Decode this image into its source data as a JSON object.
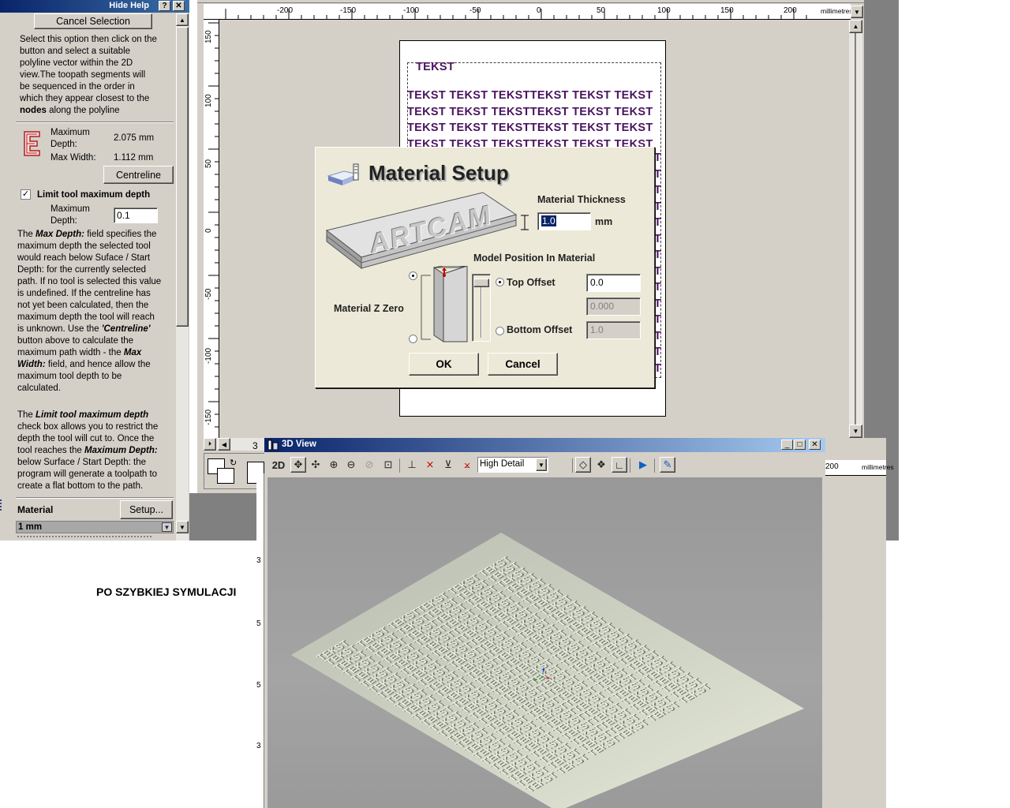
{
  "help_panel": {
    "title": "Hide Help",
    "help_btn": "?",
    "close_btn": "✕",
    "cancel_selection": "Cancel Selection",
    "intro_lines": [
      "Select this option then click on the",
      "button and select a suitable",
      "polyline vector within the 2D",
      "view.The toopath segments will",
      "be sequenced in the order in",
      "which they appear closest to the"
    ],
    "intro_last_bold": "nodes",
    "intro_last_rest": " along the polyline",
    "max_depth_label_1": "Maximum",
    "max_depth_label_2": "Depth:",
    "max_depth_value": "2.075 mm",
    "max_width_label": "Max Width:",
    "max_width_value": "1.112 mm",
    "centreline_btn": "Centreline",
    "limit_checkbox_label": "Limit tool maximum depth",
    "limit_depth_label_1": "Maximum",
    "limit_depth_label_2": "Depth:",
    "limit_depth_value": "0.1",
    "para1_lines": [
      [
        "The ",
        "Max Depth:",
        " field specifies the"
      ],
      [
        "maximum depth the selected tool",
        "",
        ""
      ],
      [
        "would reach below Suface / Start",
        "",
        ""
      ],
      [
        "Depth: for the currently selected",
        "",
        ""
      ],
      [
        "path. If no tool is selected this value",
        "",
        ""
      ],
      [
        "is undefined. If the centreline has",
        "",
        ""
      ],
      [
        "not yet been calculated, then the",
        "",
        ""
      ],
      [
        "maximum depth the tool will reach",
        "",
        ""
      ],
      [
        "is unknown. Use the ",
        "'Centreline'",
        ""
      ],
      [
        "button above to calculate the",
        "",
        ""
      ],
      [
        "maximum path width - the ",
        "Max",
        ""
      ],
      [
        "",
        "Width:",
        " field, and hence allow the"
      ],
      [
        "maximum tool depth to be",
        "",
        ""
      ],
      [
        "calculated.",
        "",
        ""
      ]
    ],
    "para2_lines": [
      [
        "The ",
        "Limit tool maximum depth",
        ""
      ],
      [
        "check box allows you to restrict the",
        "",
        ""
      ],
      [
        "depth the tool will cut to. Once the",
        "",
        ""
      ],
      [
        "tool reaches the ",
        "Maximum Depth:",
        ""
      ],
      [
        "below Surface / Start Depth: the",
        "",
        ""
      ],
      [
        "program will generate a toolpath to",
        "",
        ""
      ],
      [
        "create a flat bottom to the path.",
        "",
        ""
      ]
    ],
    "material_label": "Material",
    "setup_btn": "Setup...",
    "material_value": "1 mm"
  },
  "ruler": {
    "unit": "millimetres",
    "h_ticks": [
      "-200",
      "-150",
      "-100",
      "-50",
      "0",
      "50",
      "100",
      "150",
      "200"
    ],
    "v_ticks": [
      "150",
      "100",
      "50",
      "0",
      "-50",
      "-100",
      "-150"
    ]
  },
  "page_text": {
    "heading": "TEKST",
    "row": "TEKST TEKST TEKSTTEKST TEKST TEKST"
  },
  "dialog": {
    "title": "Material Setup",
    "logo_text": "ARTCAM",
    "thickness_label": "Material Thickness",
    "thickness_value": "1.0",
    "thickness_unit": "mm",
    "position_label": "Model Position In Material",
    "z_zero_label": "Material Z Zero",
    "top_offset_label": "Top Offset",
    "top_offset_value": "0.0",
    "middle_value": "0.000",
    "bottom_offset_label": "Bottom Offset",
    "bottom_offset_value": "1.0",
    "ok": "OK",
    "cancel": "Cancel"
  },
  "caption": "PO SZYBKIEJ SYMULACJI",
  "view3d": {
    "title": "3D View",
    "mode_2d": "2D",
    "detail_select": "High Detail",
    "heading": "TEKST",
    "row": "TEKST TEKST TEKSTTEKST TEKST TEKST"
  },
  "side_ruler": {
    "tick": "200",
    "unit": "millimetres"
  },
  "colors": {
    "text_purple": "#4a1460",
    "title_blue": "#0a246a",
    "panel_gray": "#d4d0c8"
  }
}
